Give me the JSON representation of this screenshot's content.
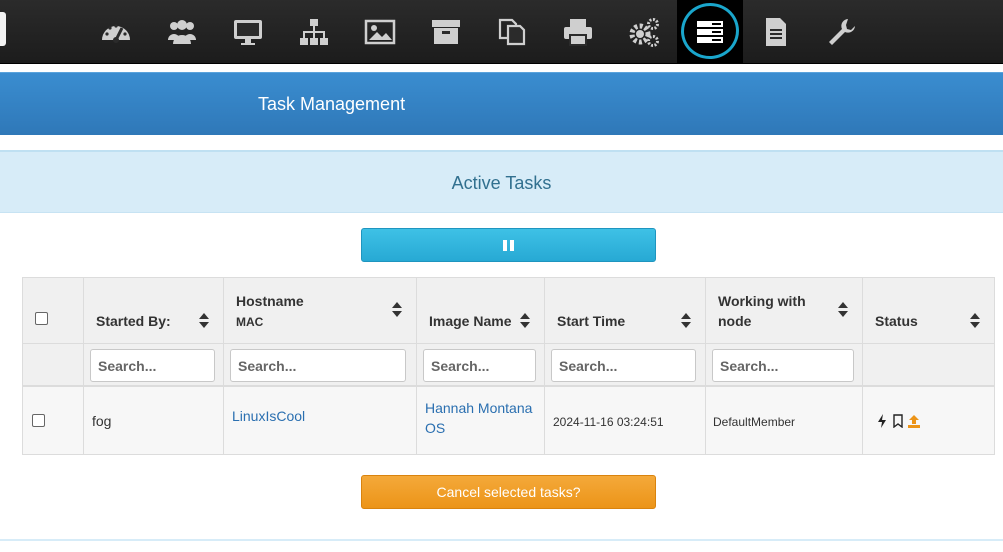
{
  "nav": {
    "icons": [
      "dashboard-icon",
      "users-icon",
      "monitor-icon",
      "sitemap-icon",
      "image-icon",
      "archive-icon",
      "copy-icon",
      "printer-icon",
      "gears-icon",
      "tasks-icon",
      "document-icon",
      "wrench-icon"
    ],
    "active": "tasks-icon"
  },
  "header": {
    "title": "Task Management"
  },
  "panel": {
    "title": "Active Tasks"
  },
  "table": {
    "columns": {
      "started_by": "Started By:",
      "hostname": "Hostname",
      "mac": "MAC",
      "image_name": "Image Name",
      "start_time": "Start Time",
      "working_with_line1": "Working with",
      "working_with_line2": "node",
      "status": "Status"
    },
    "search_placeholder": "Search...",
    "rows": [
      {
        "started_by": "fog",
        "hostname": "LinuxIsCool",
        "image_name_line1": "Hannah Montana",
        "image_name_line2": "OS",
        "start_time": "2024-11-16 03:24:51",
        "node": "DefaultMember"
      }
    ]
  },
  "buttons": {
    "cancel": "Cancel selected tasks?"
  },
  "colors": {
    "nav_bg": "#1c1c1c",
    "title_bar": "#2f78b8",
    "panel_head": "#d7ecf8",
    "pause_button": "#27a9d4",
    "cancel_button": "#ec9418",
    "link": "#2a6fb0",
    "highlight_circle": "#1aa6cc"
  }
}
